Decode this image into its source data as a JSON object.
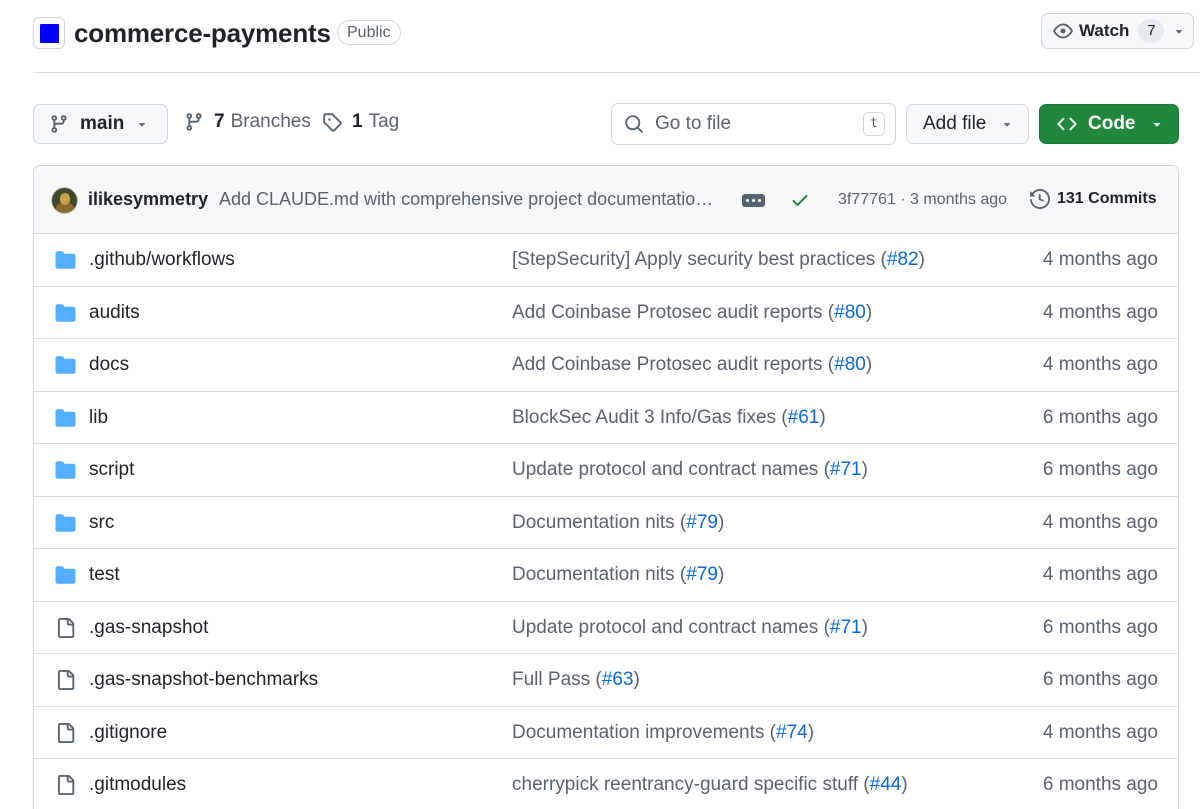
{
  "repo": {
    "name": "commerce-payments",
    "visibility": "Public",
    "logo_color": "#0000ff"
  },
  "watch": {
    "label": "Watch",
    "count": "7",
    "icon": "eye-icon"
  },
  "toolbar": {
    "branch": "main",
    "branches_count": "7",
    "branches_label": "Branches",
    "tags_count": "1",
    "tags_label": "Tag",
    "search_placeholder": "Go to file",
    "search_shortcut": "t",
    "add_file_label": "Add file",
    "code_label": "Code",
    "code_color": "#1f883d"
  },
  "latest_commit": {
    "author": "ilikesymmetry",
    "message": "Add CLAUDE.md with comprehensive project documentatio…",
    "sha_time": "3f77761 · 3 months ago",
    "commits_label": "131 Commits",
    "status": "success"
  },
  "files": [
    {
      "type": "folder",
      "name": ".github/workflows",
      "msg": "[StepSecurity] Apply security best practices (",
      "pr": "#82",
      "msg_end": ")",
      "age": "4 months ago"
    },
    {
      "type": "folder",
      "name": "audits",
      "msg": "Add Coinbase Protosec audit reports (",
      "pr": "#80",
      "msg_end": ")",
      "age": "4 months ago"
    },
    {
      "type": "folder",
      "name": "docs",
      "msg": "Add Coinbase Protosec audit reports (",
      "pr": "#80",
      "msg_end": ")",
      "age": "4 months ago"
    },
    {
      "type": "folder",
      "name": "lib",
      "msg": "BlockSec Audit 3 Info/Gas fixes (",
      "pr": "#61",
      "msg_end": ")",
      "age": "6 months ago"
    },
    {
      "type": "folder",
      "name": "script",
      "msg": "Update protocol and contract names (",
      "pr": "#71",
      "msg_end": ")",
      "age": "6 months ago"
    },
    {
      "type": "folder",
      "name": "src",
      "msg": "Documentation nits (",
      "pr": "#79",
      "msg_end": ")",
      "age": "4 months ago"
    },
    {
      "type": "folder",
      "name": "test",
      "msg": "Documentation nits (",
      "pr": "#79",
      "msg_end": ")",
      "age": "4 months ago"
    },
    {
      "type": "file",
      "name": ".gas-snapshot",
      "msg": "Update protocol and contract names (",
      "pr": "#71",
      "msg_end": ")",
      "age": "6 months ago"
    },
    {
      "type": "file",
      "name": ".gas-snapshot-benchmarks",
      "msg": "Full Pass (",
      "pr": "#63",
      "msg_end": ")",
      "age": "6 months ago"
    },
    {
      "type": "file",
      "name": ".gitignore",
      "msg": "Documentation improvements (",
      "pr": "#74",
      "msg_end": ")",
      "age": "4 months ago"
    },
    {
      "type": "file",
      "name": ".gitmodules",
      "msg": "cherrypick reentrancy-guard specific stuff (",
      "pr": "#44",
      "msg_end": ")",
      "age": "6 months ago"
    }
  ]
}
